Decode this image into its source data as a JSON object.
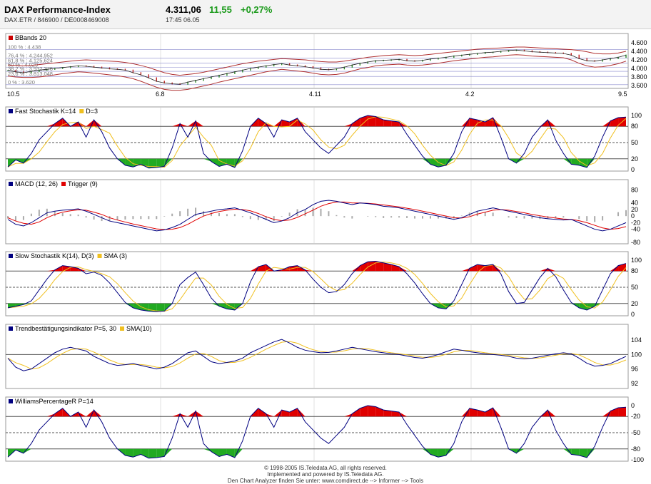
{
  "header": {
    "title": "DAX Performance-Index",
    "subtitle": "DAX.ETR / 846900 / DE0008469008",
    "price": "4.311,06",
    "change": "11,55",
    "change_pct": "+0,27%",
    "time": "17:45  06.05",
    "up_color": "#1a9a1a"
  },
  "footer": {
    "line1": "© 1998-2005 IS.Teledata AG, all rights reserved.",
    "line2": "Implemented and powered by IS.Teledata AG.",
    "line3": "Den Chart Analyzer finden Sie unter: www.comdirect.de --> Informer --> Tools"
  },
  "chart_data": [
    {
      "type": "line",
      "name": "price",
      "legend": [
        {
          "label": "BBands 20",
          "color": "#cc0000"
        }
      ],
      "x_ticks": [
        "10.5",
        "6.8",
        "4.11",
        "4.2",
        "9.5"
      ],
      "y_ticks": [
        "3.600",
        "3.800",
        "4.000",
        "4.200",
        "4.400",
        "4.600"
      ],
      "ylim": [
        3600,
        4650
      ],
      "fib_levels": [
        {
          "label": "100 % : 4.438",
          "value": 4438
        },
        {
          "label": "76,4 % : 4.244,952",
          "value": 4244.95
        },
        {
          "label": "61,8 % : 4.125,624",
          "value": 4125.62
        },
        {
          "label": "50 % : 4.029",
          "value": 4029
        },
        {
          "label": "38,2 % : 3.932,376",
          "value": 3932.38
        },
        {
          "label": "23,6 % : 3.813,048",
          "value": 3813.05
        },
        {
          "label": "0 % : 3.620",
          "value": 3620
        }
      ],
      "close": [
        3950,
        3920,
        3900,
        3930,
        3960,
        3980,
        4000,
        4020,
        4040,
        4060,
        4050,
        4030,
        4010,
        3990,
        3980,
        3960,
        3900,
        3850,
        3780,
        3700,
        3660,
        3640,
        3630,
        3680,
        3720,
        3760,
        3800,
        3840,
        3880,
        3920,
        3960,
        4000,
        4030,
        4060,
        4090,
        4110,
        4080,
        4060,
        4040,
        4010,
        3980,
        3970,
        3990,
        4030,
        4080,
        4120,
        4150,
        4180,
        4190,
        4200,
        4210,
        4180,
        4170,
        4190,
        4220,
        4240,
        4260,
        4290,
        4310,
        4330,
        4350,
        4370,
        4380,
        4400,
        4420,
        4430,
        4410,
        4390,
        4380,
        4370,
        4360,
        4350,
        4310,
        4230,
        4180,
        4170,
        4200,
        4230,
        4260,
        4311
      ],
      "upper": [
        4080,
        4070,
        4060,
        4070,
        4090,
        4110,
        4130,
        4150,
        4170,
        4190,
        4200,
        4190,
        4180,
        4170,
        4160,
        4140,
        4110,
        4070,
        4020,
        3960,
        3900,
        3860,
        3840,
        3860,
        3880,
        3910,
        3950,
        3990,
        4030,
        4070,
        4110,
        4140,
        4170,
        4190,
        4210,
        4230,
        4220,
        4210,
        4200,
        4180,
        4160,
        4150,
        4150,
        4170,
        4200,
        4230,
        4260,
        4280,
        4300,
        4310,
        4320,
        4310,
        4300,
        4310,
        4330,
        4350,
        4370,
        4390,
        4410,
        4430,
        4450,
        4460,
        4470,
        4480,
        4490,
        4500,
        4500,
        4490,
        4480,
        4470,
        4460,
        4450,
        4440,
        4420,
        4390,
        4350,
        4340,
        4340,
        4360,
        4400
      ],
      "lower": [
        3820,
        3800,
        3790,
        3790,
        3800,
        3820,
        3850,
        3880,
        3900,
        3920,
        3910,
        3890,
        3870,
        3850,
        3830,
        3800,
        3760,
        3700,
        3630,
        3560,
        3510,
        3490,
        3490,
        3510,
        3550,
        3590,
        3630,
        3680,
        3720,
        3760,
        3800,
        3840,
        3880,
        3920,
        3950,
        3980,
        3960,
        3940,
        3920,
        3890,
        3860,
        3850,
        3860,
        3890,
        3940,
        3990,
        4020,
        4060,
        4080,
        4090,
        4100,
        4080,
        4070,
        4080,
        4100,
        4120,
        4150,
        4180,
        4200,
        4220,
        4240,
        4260,
        4270,
        4290,
        4310,
        4320,
        4310,
        4290,
        4280,
        4270,
        4260,
        4250,
        4200,
        4120,
        4060,
        4030,
        4040,
        4070,
        4110,
        4170
      ]
    },
    {
      "type": "line",
      "name": "fast_stochastic",
      "legend": [
        {
          "label": "Fast Stochastik K=14",
          "color": "#000080"
        },
        {
          "label": "D=3",
          "color": "#f0c020"
        }
      ],
      "y_ticks": [
        "0",
        "20",
        "50",
        "80",
        "100"
      ],
      "ylim": [
        0,
        100
      ],
      "ref_lines": [
        20,
        50,
        80
      ],
      "fill": {
        "overbought": 80,
        "oversold": 20
      },
      "values": [
        5,
        18,
        12,
        30,
        55,
        70,
        85,
        95,
        80,
        88,
        60,
        92,
        70,
        40,
        20,
        8,
        5,
        10,
        3,
        4,
        6,
        40,
        85,
        60,
        90,
        30,
        15,
        6,
        10,
        4,
        35,
        80,
        95,
        85,
        60,
        92,
        88,
        95,
        70,
        55,
        40,
        30,
        45,
        60,
        85,
        95,
        100,
        98,
        92,
        90,
        88,
        65,
        45,
        25,
        10,
        5,
        8,
        30,
        70,
        95,
        92,
        88,
        96,
        60,
        20,
        12,
        30,
        60,
        78,
        92,
        55,
        30,
        10,
        8,
        4,
        25,
        60,
        90,
        96,
        97
      ]
    },
    {
      "type": "line",
      "name": "macd",
      "legend": [
        {
          "label": "MACD (12, 26)",
          "color": "#000080"
        },
        {
          "label": "Trigger (9)",
          "color": "#e00000"
        }
      ],
      "y_ticks": [
        "-80",
        "-40",
        "-20",
        "0",
        "20",
        "40",
        "80"
      ],
      "ylim": [
        -80,
        85
      ],
      "values": [
        -10,
        -25,
        -30,
        -20,
        -5,
        10,
        15,
        18,
        20,
        22,
        15,
        5,
        -5,
        -15,
        -20,
        -25,
        -30,
        -35,
        -40,
        -45,
        -42,
        -35,
        -25,
        -10,
        5,
        10,
        15,
        20,
        22,
        25,
        18,
        10,
        0,
        -10,
        -20,
        -15,
        -5,
        10,
        20,
        35,
        45,
        48,
        45,
        40,
        35,
        40,
        38,
        35,
        30,
        28,
        25,
        20,
        15,
        10,
        5,
        0,
        -5,
        -10,
        -5,
        5,
        15,
        20,
        25,
        20,
        15,
        10,
        5,
        0,
        -5,
        -8,
        -10,
        -12,
        -10,
        -20,
        -30,
        -40,
        -45,
        -40,
        -30,
        -20
      ],
      "trigger": [
        -5,
        -15,
        -22,
        -25,
        -18,
        -5,
        5,
        12,
        16,
        19,
        18,
        12,
        5,
        -5,
        -12,
        -18,
        -24,
        -29,
        -34,
        -39,
        -41,
        -40,
        -35,
        -25,
        -12,
        0,
        8,
        14,
        18,
        21,
        20,
        16,
        8,
        -2,
        -10,
        -14,
        -12,
        -4,
        7,
        18,
        30,
        38,
        43,
        43,
        40,
        40,
        39,
        37,
        34,
        31,
        28,
        24,
        20,
        15,
        10,
        5,
        0,
        -5,
        -6,
        -2,
        6,
        12,
        18,
        20,
        18,
        14,
        10,
        5,
        1,
        -3,
        -6,
        -9,
        -10,
        -14,
        -20,
        -28,
        -36,
        -40,
        -38,
        -32
      ],
      "histogram_scale": 0.5
    },
    {
      "type": "line",
      "name": "slow_stochastic",
      "legend": [
        {
          "label": "Slow Stochastik K(14), D(3)",
          "color": "#000080"
        },
        {
          "label": "SMA (3)",
          "color": "#f0c020"
        }
      ],
      "y_ticks": [
        "0",
        "20",
        "50",
        "80",
        "100"
      ],
      "ylim": [
        0,
        100
      ],
      "ref_lines": [
        20,
        50,
        80
      ],
      "fill": {
        "overbought": 80,
        "oversold": 20
      },
      "values": [
        12,
        15,
        18,
        25,
        45,
        65,
        82,
        90,
        88,
        85,
        75,
        78,
        72,
        58,
        40,
        22,
        12,
        8,
        6,
        5,
        6,
        20,
        55,
        68,
        78,
        55,
        30,
        15,
        10,
        8,
        20,
        60,
        88,
        92,
        80,
        82,
        88,
        90,
        82,
        65,
        50,
        40,
        42,
        55,
        75,
        90,
        97,
        98,
        95,
        92,
        88,
        75,
        58,
        38,
        20,
        12,
        10,
        25,
        55,
        85,
        92,
        90,
        92,
        75,
        42,
        20,
        22,
        45,
        68,
        85,
        70,
        45,
        22,
        12,
        8,
        15,
        45,
        75,
        90,
        94
      ]
    },
    {
      "type": "line",
      "name": "trend",
      "legend": [
        {
          "label": "Trendbestätigungsindikator P=5, 30",
          "color": "#000080"
        },
        {
          "label": "SMA(10)",
          "color": "#f0c020"
        }
      ],
      "y_ticks": [
        "92",
        "96",
        "100",
        "104"
      ],
      "ylim": [
        91,
        106
      ],
      "ref_lines": [
        100
      ],
      "values": [
        99,
        96.5,
        95.5,
        96,
        97.5,
        99,
        100.5,
        101.5,
        102,
        101.5,
        101,
        99.5,
        98.5,
        97.5,
        97,
        97.2,
        97.5,
        97,
        96.5,
        96,
        96.5,
        97.5,
        99,
        100.5,
        101,
        99.5,
        98,
        97.5,
        97.8,
        98.2,
        99,
        100.5,
        101.5,
        102.5,
        103.5,
        104.2,
        103.2,
        102,
        101.2,
        100.8,
        100.5,
        100.6,
        101,
        101.5,
        102,
        101.6,
        101.2,
        100.8,
        100.5,
        100.2,
        100,
        99.6,
        99.2,
        99,
        99.4,
        100,
        100.8,
        101.5,
        101.2,
        100.8,
        100.5,
        100.2,
        100,
        99.8,
        99.5,
        99,
        98.8,
        99,
        99.4,
        99.8,
        100.2,
        100.5,
        100.2,
        99,
        97.6,
        96.8,
        97,
        97.5,
        98.5,
        99.5
      ]
    },
    {
      "type": "line",
      "name": "williams_r",
      "legend": [
        {
          "label": "WilliamsPercentageR P=14",
          "color": "#000080"
        }
      ],
      "y_ticks": [
        "-100",
        "-80",
        "-50",
        "-20",
        "0"
      ],
      "ylim": [
        -100,
        0
      ],
      "ref_lines": [
        -80,
        -50,
        -20
      ],
      "fill": {
        "overbought": -20,
        "oversold": -80
      },
      "values": [
        -95,
        -82,
        -88,
        -70,
        -45,
        -30,
        -15,
        -5,
        -20,
        -12,
        -40,
        -8,
        -30,
        -60,
        -80,
        -92,
        -95,
        -90,
        -97,
        -96,
        -94,
        -60,
        -15,
        -40,
        -10,
        -70,
        -85,
        -94,
        -90,
        -96,
        -65,
        -20,
        -5,
        -15,
        -40,
        -8,
        -12,
        -5,
        -30,
        -45,
        -60,
        -70,
        -55,
        -40,
        -15,
        -5,
        0,
        -2,
        -8,
        -10,
        -12,
        -35,
        -55,
        -75,
        -90,
        -95,
        -92,
        -70,
        -30,
        -5,
        -8,
        -12,
        -4,
        -40,
        -80,
        -88,
        -70,
        -40,
        -22,
        -8,
        -45,
        -70,
        -90,
        -92,
        -96,
        -75,
        -40,
        -10,
        -4,
        -3
      ]
    }
  ]
}
